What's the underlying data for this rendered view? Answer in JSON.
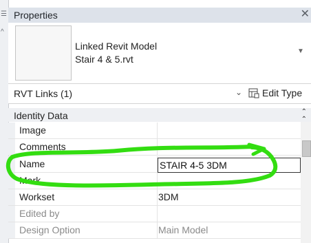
{
  "panel": {
    "title": "Properties"
  },
  "type_selector": {
    "line1": "Linked Revit Model",
    "line2": "Stair 4 & 5.rvt"
  },
  "filter": {
    "label": "RVT Links (1)",
    "edit_type_label": "Edit Type"
  },
  "section": {
    "title": "Identity Data"
  },
  "rows": [
    {
      "label": "Image",
      "value": ""
    },
    {
      "label": "Comments",
      "value": ""
    },
    {
      "label": "Name",
      "value": "STAIR 4-5 3DM"
    },
    {
      "label": "Mark",
      "value": ""
    },
    {
      "label": "Workset",
      "value": "3DM"
    },
    {
      "label": "Edited by",
      "value": ""
    },
    {
      "label": "Design Option",
      "value": "Main Model"
    }
  ],
  "icons": {
    "close": "close-icon",
    "dropdown": "chevron-down-icon",
    "edit_type": "edit-type-icon",
    "collapse": "collapse-section-icon"
  },
  "colors": {
    "annotation": "#33dd11",
    "header_bg": "#dde2ea"
  }
}
